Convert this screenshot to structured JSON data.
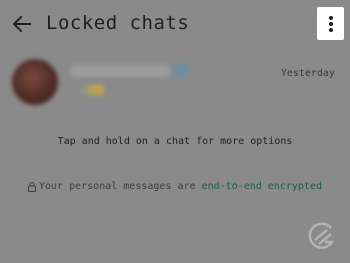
{
  "header": {
    "title": "Locked chats",
    "back_icon": "arrow-left-icon",
    "menu_icon": "more-vert-icon"
  },
  "chat_list": [
    {
      "time": "Yesterday"
    }
  ],
  "hint": "Tap and hold on a chat for more options",
  "encryption": {
    "lock_icon": "lock-icon",
    "text": "Your personal messages are ",
    "link_text": "end-to-end encrypted",
    "link_color": "#1e5a45"
  },
  "colors": {
    "overlay_background": "#8a8a8a",
    "menu_highlight": "#ffffff"
  }
}
